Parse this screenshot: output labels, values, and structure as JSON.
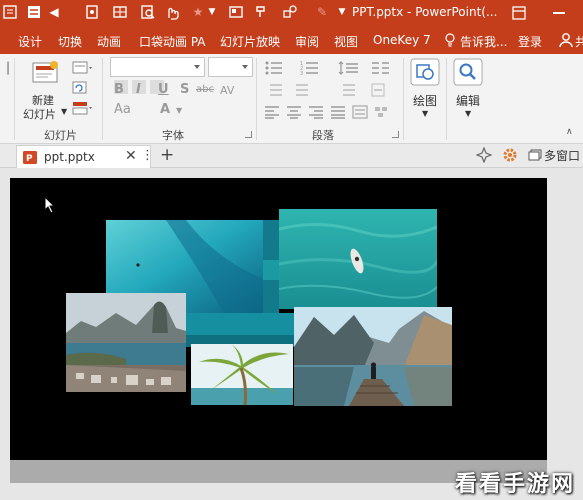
{
  "titlebar": {
    "doc_title": "PPT.pptx - PowerPoint(...",
    "bg_color": "#c43e1c"
  },
  "tabs": [
    {
      "label": "设计"
    },
    {
      "label": "切换"
    },
    {
      "label": "动画"
    },
    {
      "label": "口袋动画 PA"
    },
    {
      "label": "幻灯片放映"
    },
    {
      "label": "审阅"
    },
    {
      "label": "视图"
    },
    {
      "label": "OneKey 7"
    },
    {
      "label": "告诉我..."
    },
    {
      "label": "登录"
    },
    {
      "label": "共"
    }
  ],
  "ribbon": {
    "slides": {
      "new_slide_label_1": "新建",
      "new_slide_label_2": "幻灯片",
      "group_label": "幻灯片"
    },
    "font": {
      "group_label": "字体",
      "bold": "B",
      "italic": "I",
      "underline": "U",
      "shadow": "S",
      "strike": "abc",
      "spacing": "AV",
      "case": "Aa",
      "color": "A"
    },
    "paragraph": {
      "group_label": "段落"
    },
    "drawing": {
      "label": "绘图"
    },
    "editing": {
      "label": "编辑"
    }
  },
  "document_tabs": {
    "active": "ppt.pptx",
    "close": "✕",
    "more": "⋮",
    "add": "+",
    "right_label": "多窗口"
  },
  "watermark": "看看手游网",
  "icons": [
    "file-icon",
    "home-icon",
    "save-icon",
    "undo-icon",
    "redo-icon",
    "star-icon",
    "chevron-down-icon",
    "ppt-icon",
    "close-icon",
    "plus-icon",
    "gear-icon",
    "window-icon",
    "lightbulb-icon",
    "person-icon",
    "cursor-icon"
  ]
}
